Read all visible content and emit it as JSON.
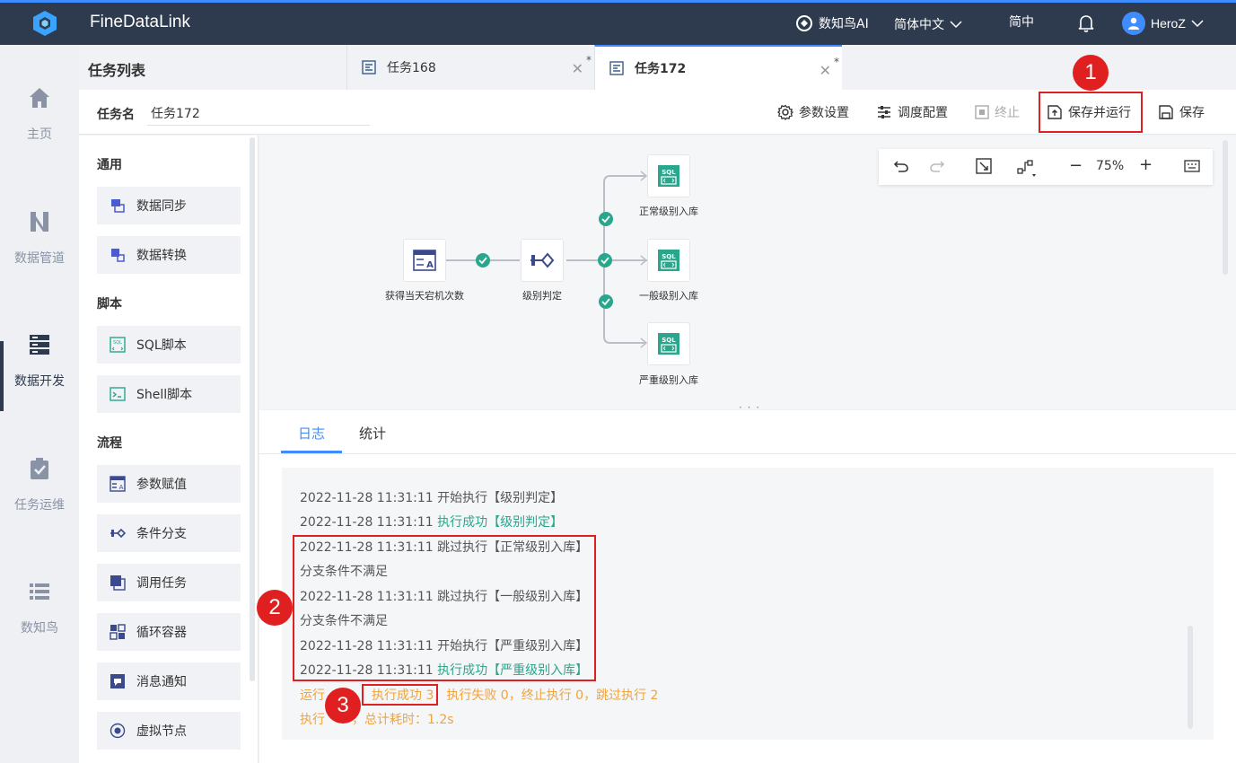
{
  "app": {
    "name": "FineDataLink"
  },
  "topbar": {
    "ai_label": "数知鸟AI",
    "language": "简体中文",
    "simplified": "简中",
    "user": "HeroZ"
  },
  "leftnav": [
    {
      "label": "主页",
      "icon": "home-icon"
    },
    {
      "label": "数据管道",
      "icon": "pipeline-icon"
    },
    {
      "label": "数据开发",
      "icon": "server-icon",
      "active": true
    },
    {
      "label": "任务运维",
      "icon": "clipboard-check-icon"
    },
    {
      "label": "数知鸟",
      "icon": "list-icon"
    }
  ],
  "task_list_title": "任务列表",
  "tabs": [
    {
      "label": "任务168",
      "modified": "*"
    },
    {
      "label": "任务172",
      "modified": "*",
      "active": true
    }
  ],
  "toolbar": {
    "task_name_label": "任务名",
    "task_name_value": "任务172",
    "param_settings": "参数设置",
    "schedule_config": "调度配置",
    "stop": "终止",
    "save_and_run": "保存并运行",
    "save": "保存"
  },
  "components": {
    "sections": [
      "通用",
      "脚本",
      "流程"
    ],
    "general": [
      "数据同步",
      "数据转换"
    ],
    "script": [
      "SQL脚本",
      "Shell脚本"
    ],
    "flow": [
      "参数赋值",
      "条件分支",
      "调用任务",
      "循环容器",
      "消息通知",
      "虚拟节点"
    ]
  },
  "canvas": {
    "zoom": "75%",
    "nodes": [
      "获得当天宕机次数",
      "级别判定",
      "正常级别入库",
      "一般级别入库",
      "严重级别入库"
    ]
  },
  "bottom_tabs": [
    "日志",
    "统计"
  ],
  "log": [
    {
      "time": "2022-11-28 11:31:11",
      "text": "开始执行【级别判定】",
      "status": "normal"
    },
    {
      "time": "2022-11-28 11:31:11",
      "text": "执行成功【级别判定】",
      "status": "success"
    },
    {
      "time": "2022-11-28 11:31:11",
      "text": "跳过执行【正常级别入库】",
      "status": "normal"
    },
    {
      "time": "",
      "text": "分支条件不满足",
      "status": "normal"
    },
    {
      "time": "2022-11-28 11:31:11",
      "text": "跳过执行【一般级别入库】",
      "status": "normal"
    },
    {
      "time": "",
      "text": "分支条件不满足",
      "status": "normal"
    },
    {
      "time": "2022-11-28 11:31:11",
      "text": "开始执行【严重级别入库】",
      "status": "normal"
    },
    {
      "time": "2022-11-28 11:31:11",
      "text": "执行成功【严重级别入库】",
      "status": "success"
    }
  ],
  "summary": {
    "line1_prefix": "运行",
    "line1_highlight": "执行成功 3",
    "line1_rest": "，执行失败 0，终止执行 0，跳过执行 2",
    "line2_prefix": "执行",
    "line2_rest": "，总计耗时：1.2s"
  },
  "badges": [
    "1",
    "2",
    "3"
  ]
}
